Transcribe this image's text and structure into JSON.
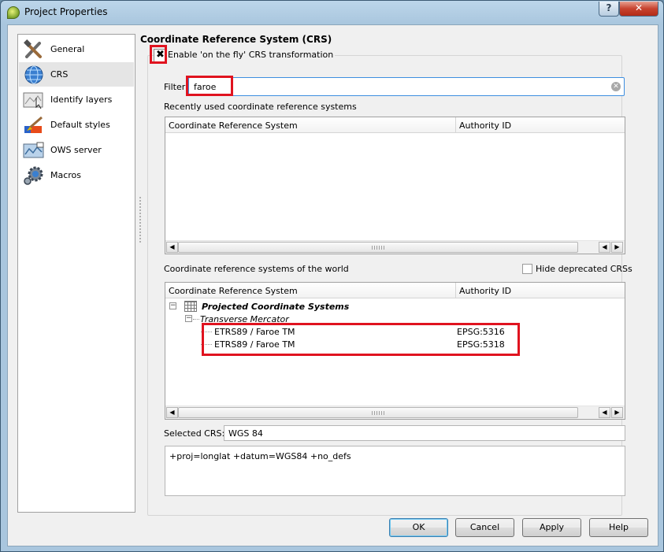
{
  "window": {
    "title": "Project Properties",
    "help_button": "?",
    "close_button": "✕"
  },
  "sidebar": {
    "items": [
      {
        "label": "General",
        "icon": "tools-icon"
      },
      {
        "label": "CRS",
        "icon": "globe-icon"
      },
      {
        "label": "Identify layers",
        "icon": "map-identify-icon"
      },
      {
        "label": "Default styles",
        "icon": "paintbrush-icon"
      },
      {
        "label": "OWS server",
        "icon": "ows-map-icon"
      },
      {
        "label": "Macros",
        "icon": "gear-icon"
      }
    ],
    "selected": "CRS"
  },
  "crs": {
    "title": "Coordinate Reference System (CRS)",
    "otf_label": "Enable 'on the fly' CRS transformation",
    "otf_checked": "✖",
    "filter_label": "Filter",
    "filter_value": "faroe",
    "clear_glyph": "✕",
    "recent_label": "Recently used coordinate reference systems",
    "world_label": "Coordinate reference systems of the world",
    "hide_deprecated_label": "Hide deprecated CRSs",
    "columns": [
      "Coordinate Reference System",
      "Authority ID"
    ],
    "tree": {
      "group": "Projected Coordinate Systems",
      "subgroup": "Transverse Mercator",
      "rows": [
        {
          "name": "ETRS89 / Faroe TM",
          "authority": "EPSG:5316"
        },
        {
          "name": "ETRS89 / Faroe TM",
          "authority": "EPSG:5318"
        }
      ],
      "expander": "−"
    },
    "selected_label": "Selected CRS:",
    "selected_value": "WGS 84",
    "proj_string": "+proj=longlat +datum=WGS84 +no_defs"
  },
  "scrollbar": {
    "left": "◀",
    "right": "▶"
  },
  "buttons": {
    "ok": "OK",
    "cancel": "Cancel",
    "apply": "Apply",
    "help": "Help"
  },
  "colors": {
    "highlight": "#e0131f",
    "focus_border": "#3d8ee0"
  }
}
